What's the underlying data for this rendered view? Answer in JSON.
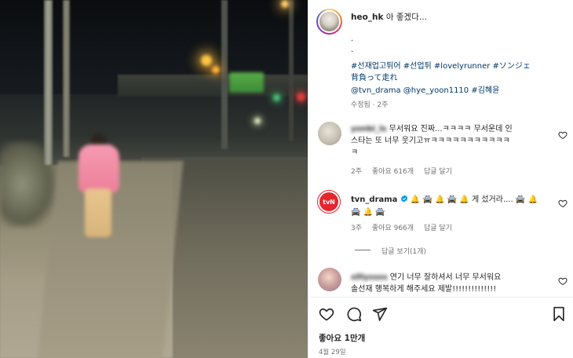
{
  "post": {
    "author": "heo_hk",
    "caption": "아 좋겠다...",
    "dot1": ".",
    "dot2": ".",
    "hashtags_line1": "#선재업고튀어 #선업튀 #lovelyrunner #ソンジェ",
    "hashtags_line2": "背負って走れ",
    "mentions_line": "@tvn_drama @hye_yoon1110 #김혜윤",
    "edited_time": "수정됨 · 2주"
  },
  "comments": [
    {
      "username": "yonbi_ls",
      "text_line1": "무서워요 진짜...ㅋㅋㅋㅋ 무서운데 인",
      "text_line2": "스타는 또 너무 웃기고ㅠㅋㅋㅋㅋㅋㅋㅋㅋㅋㅋㅋ",
      "text_line3": "ㅋ",
      "time": "2주",
      "likes": "좋아요 616개",
      "reply": "답글 달기"
    },
    {
      "username": "tvn_drama",
      "verified": true,
      "text_line1": "🔔 🚔 🔔 🚔 🔔 게 섰거라.... 🚔 🔔",
      "text_line2": "🚔 🔔 🚔",
      "time": "3주",
      "likes": "좋아요 966개",
      "reply": "답글 달기",
      "view_replies": "답글 보기(1개)"
    },
    {
      "username": "slllyssss",
      "text_line1": "연기 너무 잘하셔서 너무 무서워요",
      "text_line2": "솔선재 행복하게 해주세요 제발!!!!!!!!!!!!!!"
    }
  ],
  "tvn_avatar_text": "tvN",
  "footer": {
    "likes": "좋아요 1만개",
    "date": "4월 29일"
  },
  "icons": {
    "like": "heart-icon",
    "comment": "comment-icon",
    "share": "share-icon",
    "save": "bookmark-icon",
    "verified": "verified-badge-icon"
  },
  "colors": {
    "link": "#00376b",
    "muted": "#737373",
    "text": "#262626",
    "verified": "#0095f6",
    "tvn_red": "#e6252d"
  }
}
